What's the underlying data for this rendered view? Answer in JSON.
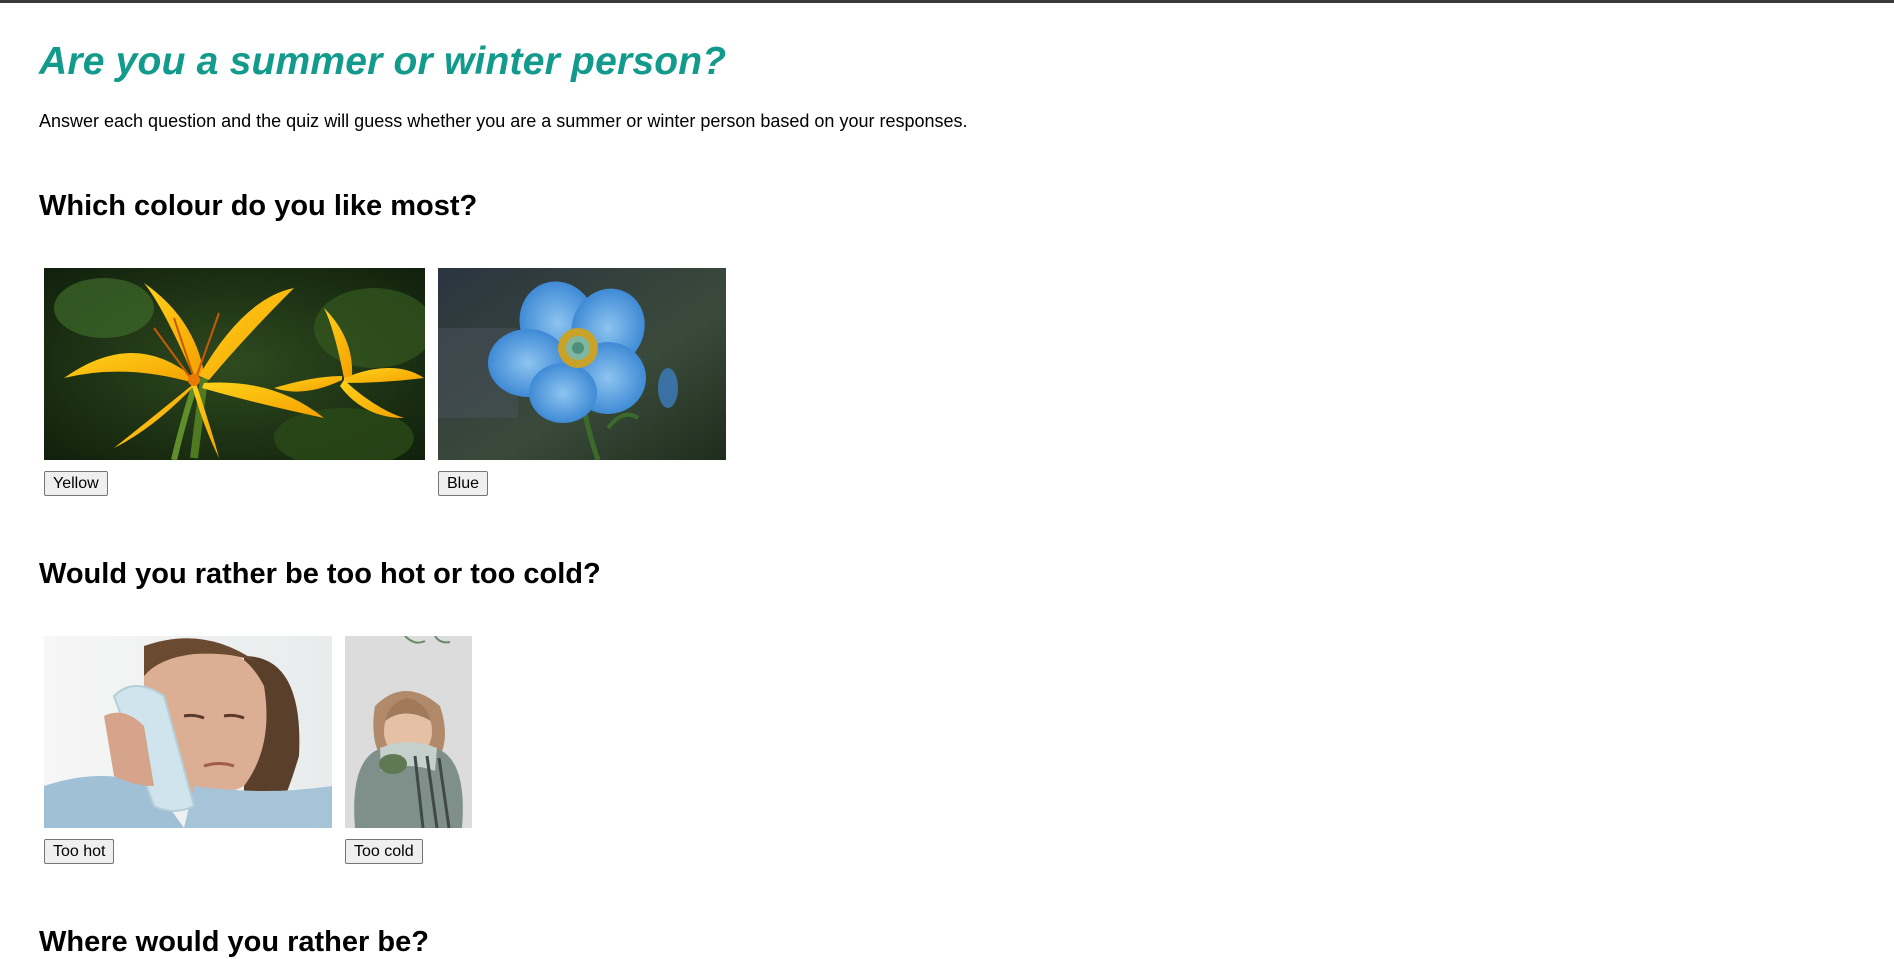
{
  "quiz": {
    "title": "Are you a summer or winter person?",
    "intro": "Answer each question and the quiz will guess whether you are a summer or winter person based on your responses.",
    "questions": [
      {
        "text": "Which colour do you like most?",
        "options": [
          {
            "label": "Yellow",
            "image_icon": "yellow-lily-photo"
          },
          {
            "label": "Blue",
            "image_icon": "blue-poppy-photo"
          }
        ]
      },
      {
        "text": "Would you rather be too hot or too cold?",
        "options": [
          {
            "label": "Too hot",
            "image_icon": "woman-with-ice-pack-photo"
          },
          {
            "label": "Too cold",
            "image_icon": "woman-in-blanket-photo"
          }
        ]
      },
      {
        "text": "Where would you rather be?",
        "options": []
      }
    ]
  },
  "colors": {
    "title": "#129a8d",
    "topline": "#3a3a3a"
  }
}
